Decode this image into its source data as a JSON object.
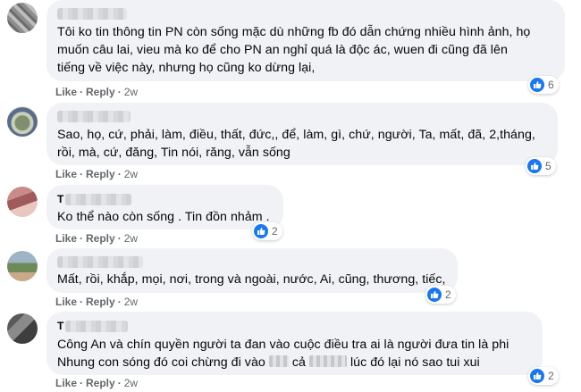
{
  "actions": {
    "like": "Like",
    "reply": "Reply",
    "separator": "·"
  },
  "colors": {
    "bubble": "#f0f2f5",
    "action_text": "#65676b",
    "like_blue": "#1877f2"
  },
  "comments": [
    {
      "lines": [
        "Tôi ko tin thông tin PN còn sống mặc dù những fb đó dẫn chứng nhiều hình ảnh, họ",
        "muốn câu lai, vieu mà ko để cho PN an nghỉ quá là độc ác, wuen đi cũng đã lên",
        "tiếng về việc này, nhưng họ cũng ko dừng lại,"
      ],
      "time": "2w",
      "reactions": "6",
      "reaction_icon": "like-icon"
    },
    {
      "lines": [
        "Sao, họ, cứ, phải, làm, điều, thất, đức,, để, làm, gì, chứ, người, Ta, mất, đã, 2,tháng,",
        "rồi, mà, cứ, đăng, Tin nói, răng, vẫn sống"
      ],
      "time": "2w",
      "reactions": "5",
      "reaction_icon": "like-icon"
    },
    {
      "name_initial": "T",
      "lines": [
        "Ko thể nào còn sống . Tin đồn nhảm ."
      ],
      "time": "2w",
      "reactions": "2",
      "reaction_icon": "like-icon"
    },
    {
      "lines": [
        "Mất, rồi, khắp, mọi, nơi, trong và ngoài, nước, Ai, cũng, thương, tiếc,"
      ],
      "time": "2w",
      "reactions": "2",
      "reaction_icon": "like-icon"
    },
    {
      "name_initial": "T",
      "line1": "Công An và chín quyền người ta đan vào cuộc điều tra ai là người đưa tin là phi",
      "line2_a": "Nhung con sóng đó coi chừng đi vào",
      "line2_b": "cả",
      "line2_c": "lúc đó lại nó sao tui xui",
      "time": "2w",
      "reactions": "2",
      "reaction_icon": "like-icon"
    }
  ]
}
